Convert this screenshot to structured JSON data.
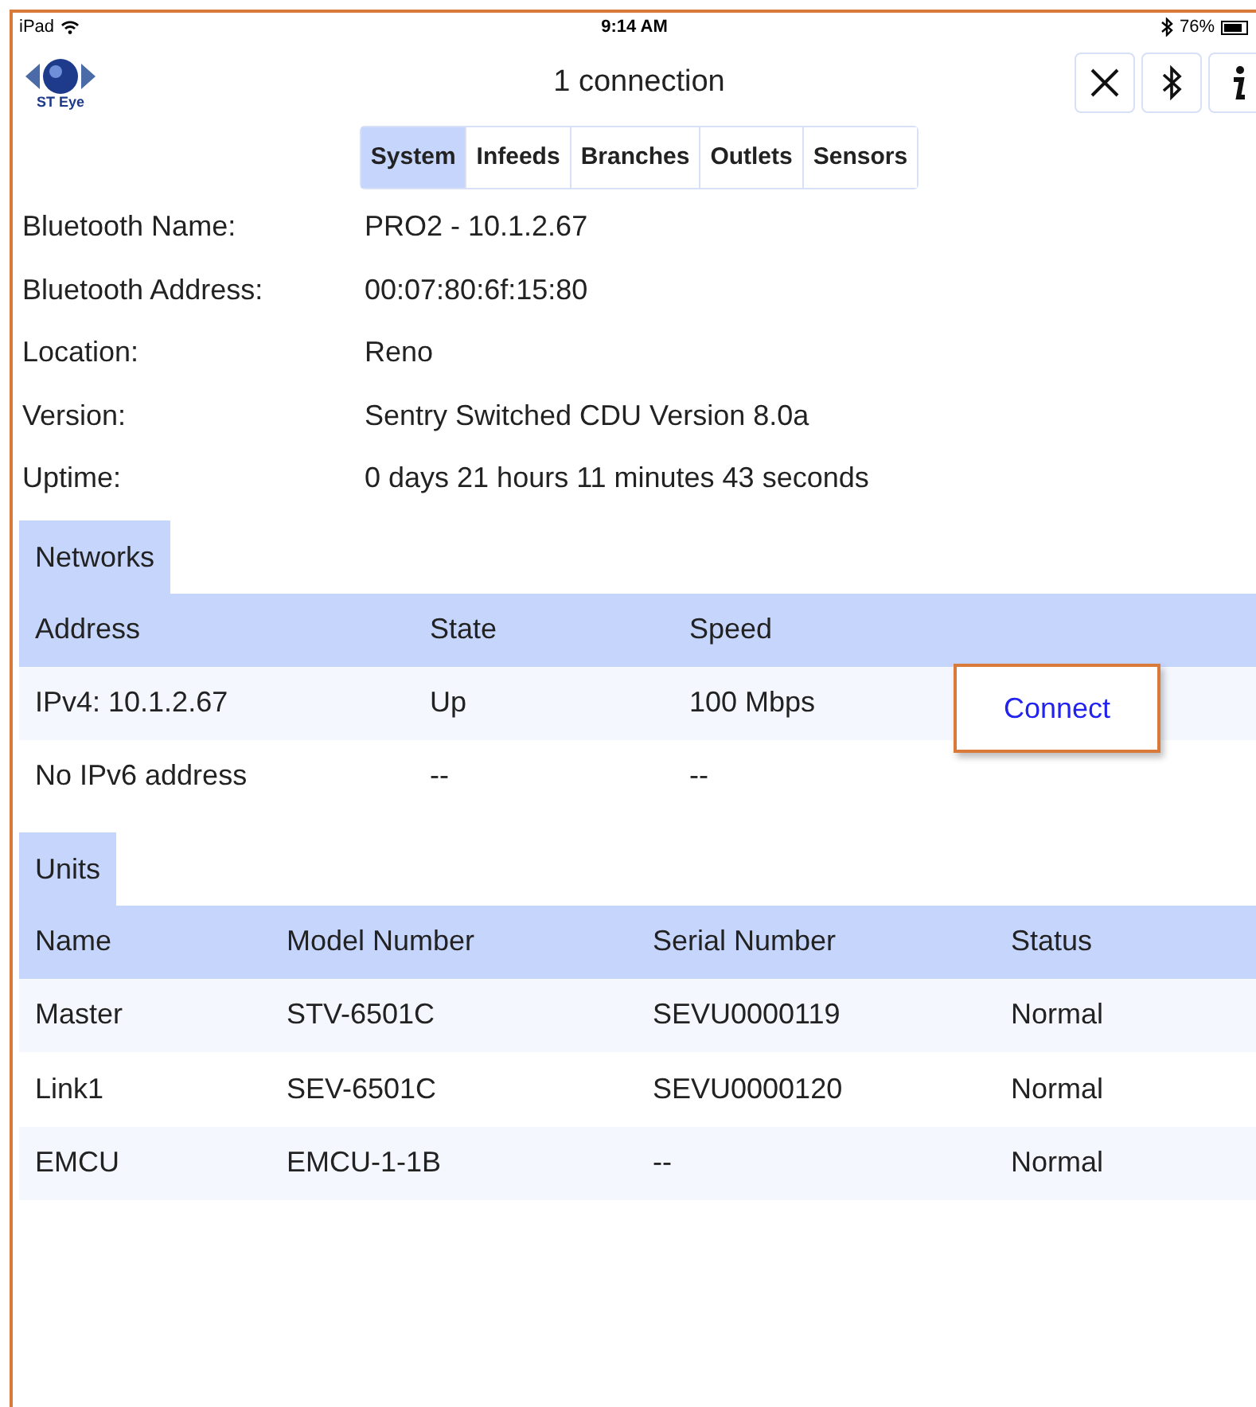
{
  "status_bar": {
    "device": "iPad",
    "time": "9:14 AM",
    "battery": "76%"
  },
  "header": {
    "logo_text": "ST Eye",
    "title": "1 connection"
  },
  "tabs": [
    {
      "label": "System",
      "selected": true
    },
    {
      "label": "Infeeds",
      "selected": false
    },
    {
      "label": "Branches",
      "selected": false
    },
    {
      "label": "Outlets",
      "selected": false
    },
    {
      "label": "Sensors",
      "selected": false
    }
  ],
  "info": [
    {
      "label": "Bluetooth Name:",
      "value": "PRO2 - 10.1.2.67"
    },
    {
      "label": "Bluetooth Address:",
      "value": "00:07:80:6f:15:80"
    },
    {
      "label": "Location:",
      "value": "Reno"
    },
    {
      "label": "Version:",
      "value": "Sentry Switched CDU Version 8.0a"
    },
    {
      "label": "Uptime:",
      "value": "0 days 21 hours 11 minutes 43 seconds"
    }
  ],
  "networks": {
    "title": "Networks",
    "columns": [
      "Address",
      "State",
      "Speed"
    ],
    "rows": [
      {
        "cells": [
          "IPv4: 10.1.2.67",
          "Up",
          "100 Mbps"
        ],
        "action": "Connect",
        "highlighted": true
      },
      {
        "cells": [
          "No IPv6 address",
          "--",
          "--"
        ]
      }
    ]
  },
  "units": {
    "title": "Units",
    "columns": [
      "Name",
      "Model Number",
      "Serial Number",
      "Status"
    ],
    "rows": [
      [
        "Master",
        "STV-6501C",
        "SEVU0000119",
        "Normal"
      ],
      [
        "Link1",
        "SEV-6501C",
        "SEVU0000120",
        "Normal"
      ],
      [
        "EMCU",
        "EMCU-1-1B",
        "--",
        "Normal"
      ]
    ]
  }
}
